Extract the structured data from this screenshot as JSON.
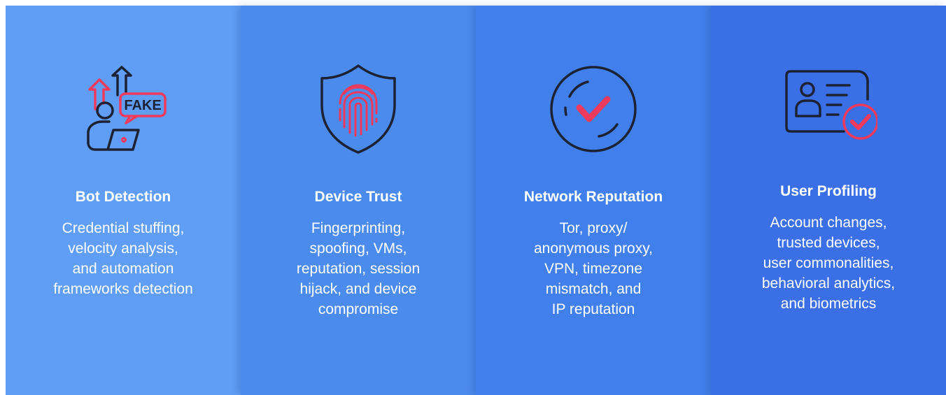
{
  "cards": [
    {
      "title": "Bot Detection",
      "lines": [
        "Credential stuffing,",
        "velocity analysis,",
        "and automation",
        "frameworks detection"
      ],
      "icon": "fake-bot-icon",
      "badge_text": "FAKE"
    },
    {
      "title": "Device Trust",
      "lines": [
        "Fingerprinting,",
        "spoofing, VMs,",
        "reputation, session",
        "hijack, and device",
        "compromise"
      ],
      "icon": "fingerprint-shield-icon"
    },
    {
      "title": "Network Reputation",
      "lines": [
        "Tor, proxy/",
        "anonymous proxy,",
        "VPN, timezone",
        "mismatch, and",
        "IP reputation"
      ],
      "icon": "check-circle-icon"
    },
    {
      "title": "User Profiling",
      "lines": [
        "Account changes,",
        "trusted devices,",
        "user commonalities,",
        "behavioral analytics,",
        "and biometrics"
      ],
      "icon": "id-card-check-icon"
    }
  ],
  "colors": {
    "card_1": "#5f9ef4",
    "card_2": "#4b8bec",
    "card_3": "#4180ea",
    "card_4": "#3a6fe6",
    "icon_dark": "#1c2233",
    "icon_accent": "#ee3a5c"
  }
}
